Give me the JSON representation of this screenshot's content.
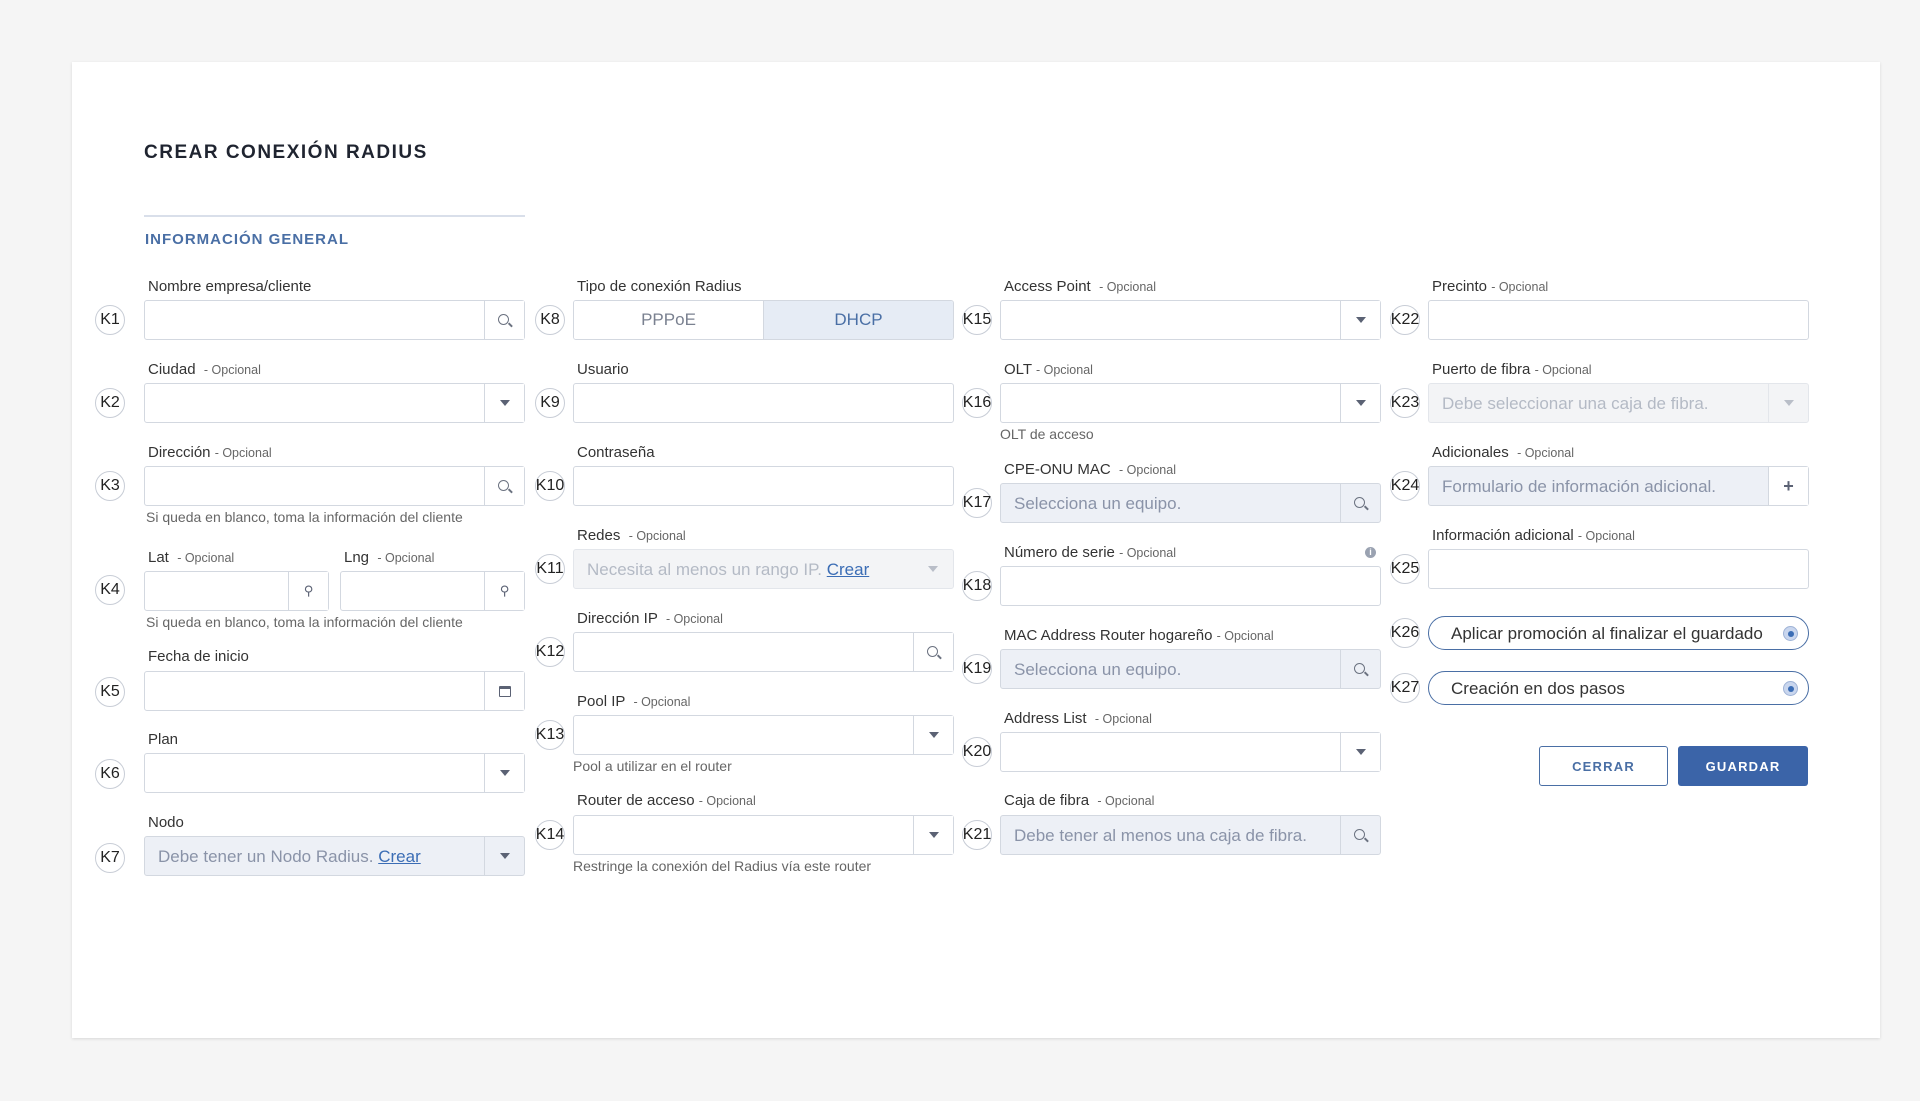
{
  "page": {
    "title": "CREAR CONEXIÓN RADIUS",
    "section": "INFORMACIÓN GENERAL"
  },
  "optional_suffix": "- Opcional",
  "keys": [
    "K1",
    "K2",
    "K3",
    "K4",
    "K5",
    "K6",
    "K7",
    "K8",
    "K9",
    "K10",
    "K11",
    "K12",
    "K13",
    "K14",
    "K15",
    "K16",
    "K17",
    "K18",
    "K19",
    "K20",
    "K21",
    "K22",
    "K23",
    "K24",
    "K25",
    "K26",
    "K27"
  ],
  "col1": {
    "nombre": {
      "label": "Nombre empresa/cliente"
    },
    "ciudad": {
      "label": "Ciudad"
    },
    "direccion": {
      "label": "Dirección",
      "help": "Si queda en blanco, toma la información del cliente"
    },
    "lat": {
      "label": "Lat"
    },
    "lng": {
      "label": "Lng",
      "help": "Si queda en blanco, toma la información del cliente"
    },
    "fecha": {
      "label": "Fecha de inicio"
    },
    "plan": {
      "label": "Plan"
    },
    "nodo": {
      "label": "Nodo",
      "placeholder": "Debe tener un Nodo Radius.",
      "link": "Crear"
    }
  },
  "col2": {
    "tipo": {
      "label": "Tipo de conexión Radius",
      "options": [
        "PPPoE",
        "DHCP"
      ],
      "selected": "DHCP"
    },
    "usuario": {
      "label": "Usuario"
    },
    "contrasena": {
      "label": "Contraseña"
    },
    "redes": {
      "label": "Redes",
      "placeholder": "Necesita al menos un rango IP.",
      "link": "Crear"
    },
    "ip": {
      "label": "Dirección IP"
    },
    "pool": {
      "label": "Pool IP",
      "help": "Pool a utilizar en el router"
    },
    "router": {
      "label": "Router de acceso",
      "help": "Restringe la conexión del Radius vía este router"
    }
  },
  "col3": {
    "ap": {
      "label": "Access Point"
    },
    "olt": {
      "label": "OLT",
      "help": "OLT de acceso"
    },
    "cpe": {
      "label": "CPE-ONU MAC",
      "placeholder": "Selecciona un equipo."
    },
    "serie": {
      "label": "Número de serie"
    },
    "mac": {
      "label": "MAC Address Router hogareño",
      "placeholder": "Selecciona un equipo."
    },
    "addrlist": {
      "label": "Address List"
    },
    "caja": {
      "label": "Caja de fibra",
      "placeholder": "Debe tener al menos una caja de fibra."
    }
  },
  "col4": {
    "precinto": {
      "label": "Precinto"
    },
    "puerto": {
      "label": "Puerto de fibra",
      "placeholder": "Debe seleccionar una caja de fibra."
    },
    "adicionales": {
      "label": "Adicionales",
      "placeholder": "Formulario de información adicional."
    },
    "info": {
      "label": "Información adicional"
    },
    "promo": {
      "label": "Aplicar promoción al finalizar el guardado"
    },
    "dospasos": {
      "label": "Creación en dos pasos"
    }
  },
  "buttons": {
    "close": "CERRAR",
    "save": "GUARDAR"
  },
  "colors": {
    "accent": "#3b64a8",
    "section": "#4a6fa5"
  },
  "icons": [
    "search-icon",
    "caret-down-icon",
    "map-pin-icon",
    "calendar-icon",
    "plus-icon",
    "info-icon"
  ]
}
